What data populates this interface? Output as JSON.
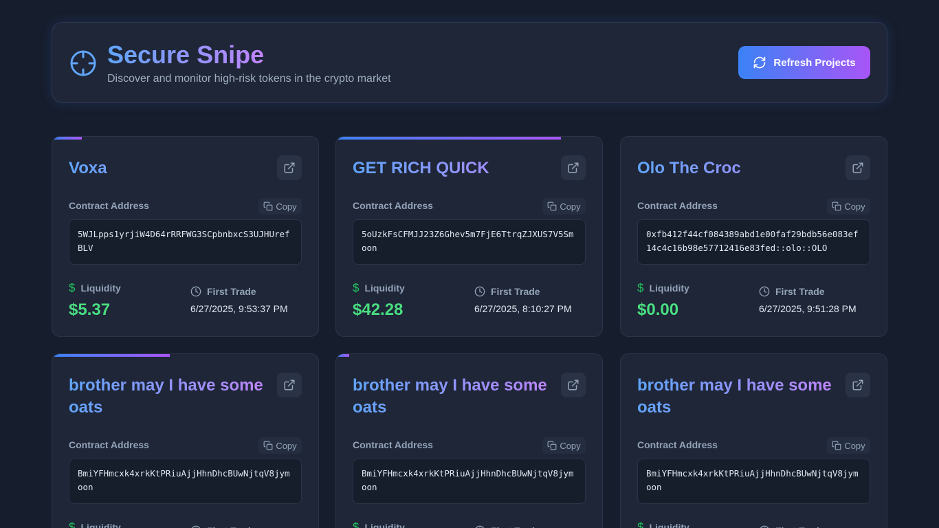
{
  "header": {
    "title": "Secure Snipe",
    "subtitle": "Discover and monitor high-risk tokens in the crypto market",
    "refresh_label": "Refresh Projects"
  },
  "labels": {
    "contract_address": "Contract Address",
    "copy": "Copy",
    "liquidity": "Liquidity",
    "first_trade": "First Trade"
  },
  "cards": [
    {
      "name": "Voxa",
      "address": "5WJLpps1yrjiW4D64rRRFWG3SCpbnbxcS3UJHUrefBLV",
      "liquidity": "$5.37",
      "first_trade": "6/27/2025, 9:53:37 PM",
      "top_bar_fraction": 0.11
    },
    {
      "name": "GET RICH QUICK",
      "address": "5oUzkFsCFMJJ23Z6Ghev5m7FjE6TtrqZJXUS7V5Smoon",
      "liquidity": "$42.28",
      "first_trade": "6/27/2025, 8:10:27 PM",
      "top_bar_fraction": 0.84
    },
    {
      "name": "Olo The Croc",
      "address": "0xfb412f44cf084389abd1e00faf29bdb56e083ef14c4c16b98e57712416e83fed::olo::OLO",
      "liquidity": "$0.00",
      "first_trade": "6/27/2025, 9:51:28 PM",
      "top_bar_fraction": 0
    },
    {
      "name": "brother may I have some oats",
      "address": "BmiYFHmcxk4xrkKtPRiuAjjHhnDhcBUwNjtqV8jymoon",
      "liquidity": "",
      "first_trade": "",
      "top_bar_fraction": 0.44
    },
    {
      "name": "brother may I have some oats",
      "address": "BmiYFHmcxk4xrkKtPRiuAjjHhnDhcBUwNjtqV8jymoon",
      "liquidity": "",
      "first_trade": "",
      "top_bar_fraction": 0.05
    },
    {
      "name": "brother may I have some oats",
      "address": "BmiYFHmcxk4xrkKtPRiuAjjHhnDhcBUwNjtqV8jymoon",
      "liquidity": "",
      "first_trade": "",
      "top_bar_fraction": 0
    }
  ],
  "colors": {
    "background": "#161d2c",
    "card": "#1e2638",
    "accent_start": "#3b82f6",
    "accent_end": "#a855f7",
    "liquidity_green": "#4ade80"
  },
  "icons": {
    "logo": "crosshair-icon",
    "refresh": "refresh-icon",
    "external": "external-link-icon",
    "copy": "copy-icon",
    "liquidity": "dollar-icon",
    "first_trade": "clock-icon"
  }
}
